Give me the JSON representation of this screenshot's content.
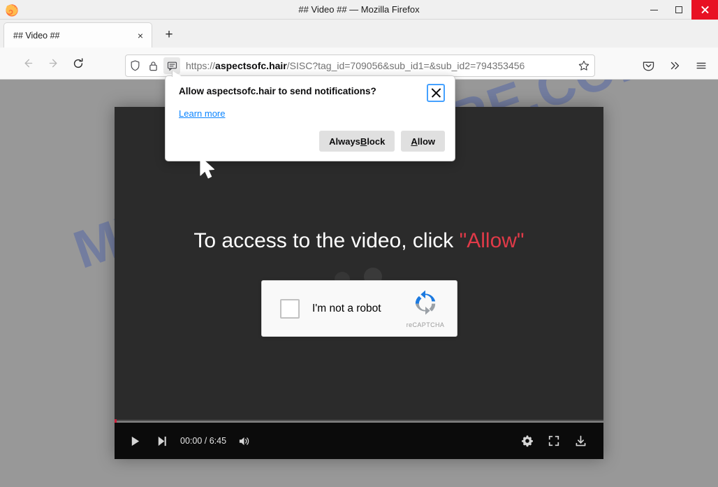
{
  "window": {
    "title": "## Video ## — Mozilla Firefox",
    "minimize_label": "Minimize",
    "maximize_label": "Maximize",
    "close_label": "Close"
  },
  "tabs": {
    "items": [
      {
        "label": "## Video ##",
        "close_label": "×"
      }
    ],
    "new_tab_label": "+"
  },
  "toolbar": {
    "back_label": "Back",
    "forward_label": "Forward",
    "reload_label": "Reload",
    "pocket_label": "Save to Pocket",
    "overflow_label": "More tools",
    "menu_label": "Open application menu"
  },
  "urlbar": {
    "scheme": "https://",
    "host": "aspectsofc.hair",
    "path": "/SISC?tag_id=709056&sub_id1=&sub_id2=794353456",
    "full": "https://aspectsofc.hair/SISC?tag_id=709056&sub_id1=&sub_id2=794353456",
    "shield_icon": "shield-icon",
    "lock_icon": "lock-icon",
    "notification_icon": "notification-permission-icon",
    "bookmark_icon": "star-icon"
  },
  "doorhanger": {
    "title": "Allow aspectsofc.hair to send notifications?",
    "learn_more": "Learn more",
    "always_block": "Always Block",
    "always_block_prefix": "Always ",
    "always_block_accesskey": "B",
    "always_block_suffix": "lock",
    "allow": "Allow",
    "allow_accesskey": "A",
    "allow_suffix": "llow",
    "close_label": "Close"
  },
  "page": {
    "watermark": "MYANTISPYWARE.COM",
    "watermark_color": "#2b4aad",
    "background_color": "#989898"
  },
  "player": {
    "headline_main": "To access to the video, click ",
    "headline_accent": "\"Allow\"",
    "accent_color": "#e03a48",
    "captcha": {
      "label": "I'm not a robot",
      "brand": "reCAPTCHA",
      "checked": false
    },
    "controls": {
      "play_label": "Play",
      "next_label": "Next",
      "time": "00:00 / 6:45",
      "current_time": "00:00",
      "duration": "6:45",
      "volume_label": "Mute",
      "settings_label": "Settings",
      "fullscreen_label": "Full screen",
      "download_label": "Download"
    },
    "progress": {
      "played_percent": 0.4,
      "played_color": "#cc1f3a",
      "track_color": "#7b7b7b"
    }
  }
}
